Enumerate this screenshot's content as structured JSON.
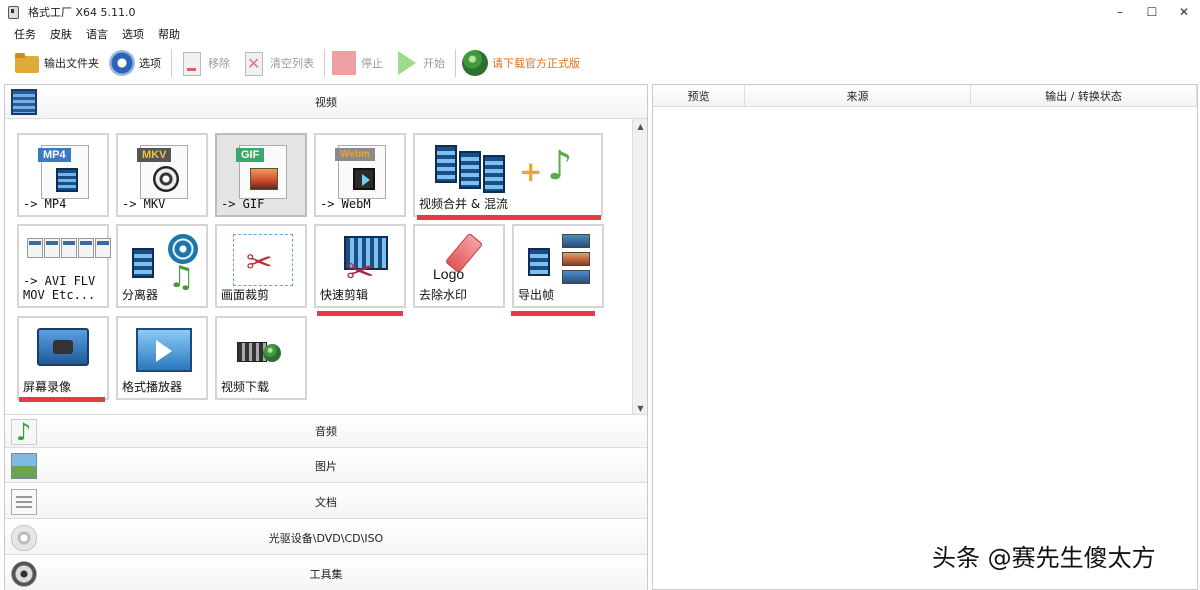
{
  "window": {
    "title": "格式工厂 X64 5.11.0",
    "controls": {
      "minimize": "–",
      "maximize": "☐",
      "close": "✕"
    }
  },
  "menu": [
    "任务",
    "皮肤",
    "语言",
    "选项",
    "帮助"
  ],
  "toolbar": {
    "output_folder": "输出文件夹",
    "options": "选项",
    "remove": "移除",
    "clear_list": "清空列表",
    "stop": "停止",
    "start": "开始",
    "download": "请下载官方正式版"
  },
  "categories": {
    "video": "视频",
    "audio": "音频",
    "image": "图片",
    "document": "文档",
    "disc": "光驱设备\\DVD\\CD\\ISO",
    "tools": "工具集"
  },
  "video_tiles": {
    "mp4": {
      "badge": "MP4",
      "label": "-> MP4"
    },
    "mkv": {
      "badge": "MKV",
      "label": "-> MKV"
    },
    "gif": {
      "badge": "GIF",
      "label": "-> GIF"
    },
    "webm": {
      "badge": "Webm",
      "label": "-> WebM"
    },
    "merge": {
      "label": "视频合并 & 混流"
    },
    "avi": {
      "label_line1": "-> AVI FLV",
      "label_line2": "MOV Etc..."
    },
    "splitter": {
      "label": "分离器"
    },
    "crop": {
      "label": "画面裁剪"
    },
    "quick_cut": {
      "label": "快速剪辑"
    },
    "remove_watermark": {
      "label": "去除水印",
      "logo_text": "Logo"
    },
    "export_frames": {
      "label": "导出帧"
    },
    "screen_record": {
      "label": "屏幕录像"
    },
    "player": {
      "label": "格式播放器"
    },
    "video_download": {
      "label": "视频下载"
    }
  },
  "task_table": {
    "columns": [
      "预览",
      "来源",
      "输出 / 转换状态"
    ]
  },
  "watermark_text": "头条 @赛先生傻太方",
  "colors": {
    "highlight_red": "#e53b46",
    "download_orange": "#e07010",
    "film_blue": "#1c4c84"
  }
}
